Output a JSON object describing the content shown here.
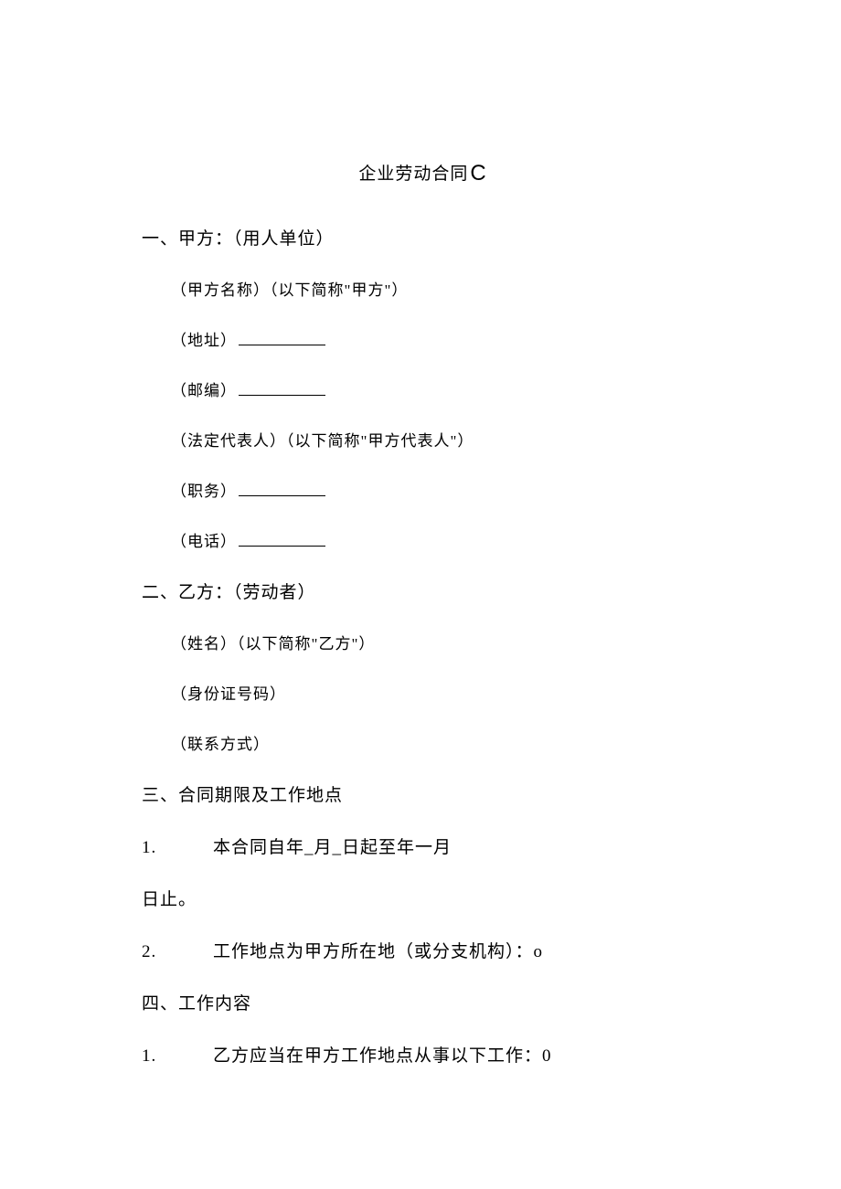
{
  "title": {
    "main": "企业劳动合同",
    "suffix": "C"
  },
  "section1": {
    "heading": "一、甲方：（用人单位）",
    "fields": {
      "name": "（甲方名称）（以下简称\"甲方\"）",
      "address": "（地址）",
      "postcode": "（邮编）",
      "legal_rep": "（法定代表人）（以下简称\"甲方代表人\"）",
      "position": "（职务）",
      "phone": "（电话）"
    }
  },
  "section2": {
    "heading": "二、乙方：（劳动者）",
    "fields": {
      "name": "（姓名）（以下简称\"乙方\"）",
      "id_number": "（身份证号码）",
      "contact": "（联系方式）"
    }
  },
  "section3": {
    "heading": "三、合同期限及工作地点",
    "items": {
      "1_num": "1.",
      "1_text": "本合同自年_月_日起至年一月",
      "1_cont": "日止。",
      "2_num": "2.",
      "2_text": "工作地点为甲方所在地（或分支机构）：o"
    }
  },
  "section4": {
    "heading": "四、工作内容",
    "items": {
      "1_num": "1.",
      "1_text": "乙方应当在甲方工作地点从事以下工作：0"
    }
  }
}
